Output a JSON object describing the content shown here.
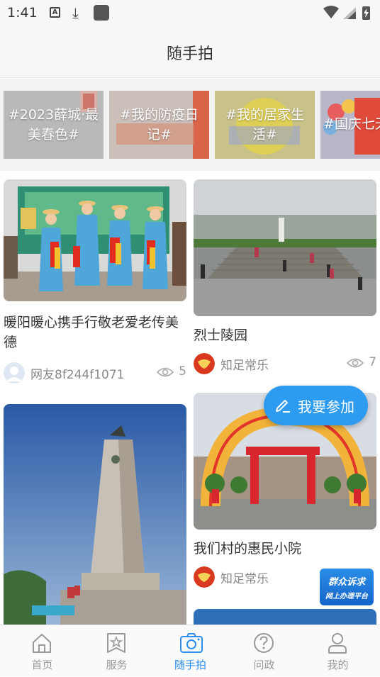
{
  "status_bar": {
    "time": "1:41",
    "a_icon_letter": "A"
  },
  "header": {
    "title": "随手拍"
  },
  "topics": [
    {
      "label": "#2023薛城·最美春色#"
    },
    {
      "label": "#我的防疫日记#"
    },
    {
      "label": "#我的居家生活#"
    },
    {
      "label": "#国庆七天"
    }
  ],
  "posts": [
    {
      "title": "暖阳暖心携手行敬老爱老传美德",
      "author": "网友8f244f1071",
      "views": "5"
    },
    {
      "title": "烈士陵园",
      "author": "知足常乐",
      "views": "7"
    },
    {
      "title": "我们村的惠民小院",
      "author": "知足常乐",
      "views": ""
    },
    {
      "title": "",
      "author": "",
      "views": ""
    }
  ],
  "join_button": {
    "label": "我要参加"
  },
  "platform_badge": {
    "line1": "群众诉求",
    "line2": "网上办理平台"
  },
  "tabbar": {
    "items": [
      {
        "label": "首页",
        "icon": "home-icon",
        "active": false
      },
      {
        "label": "服务",
        "icon": "star-bookmark-icon",
        "active": false
      },
      {
        "label": "随手拍",
        "icon": "camera-icon",
        "active": true
      },
      {
        "label": "问政",
        "icon": "question-icon",
        "active": false
      },
      {
        "label": "我的",
        "icon": "user-icon",
        "active": false
      }
    ]
  },
  "colors": {
    "accent": "#2d8ff0",
    "button": "#2d9bf0",
    "inactive_tab": "#999999"
  }
}
